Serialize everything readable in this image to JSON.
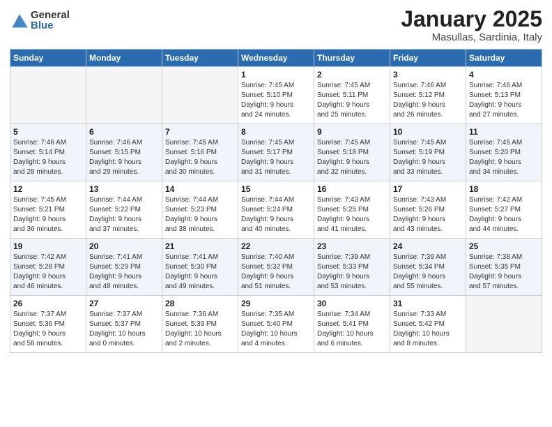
{
  "header": {
    "logo_general": "General",
    "logo_blue": "Blue",
    "month": "January 2025",
    "location": "Masullas, Sardinia, Italy"
  },
  "weekdays": [
    "Sunday",
    "Monday",
    "Tuesday",
    "Wednesday",
    "Thursday",
    "Friday",
    "Saturday"
  ],
  "weeks": [
    [
      {
        "day": "",
        "info": ""
      },
      {
        "day": "",
        "info": ""
      },
      {
        "day": "",
        "info": ""
      },
      {
        "day": "1",
        "info": "Sunrise: 7:45 AM\nSunset: 5:10 PM\nDaylight: 9 hours\nand 24 minutes."
      },
      {
        "day": "2",
        "info": "Sunrise: 7:45 AM\nSunset: 5:11 PM\nDaylight: 9 hours\nand 25 minutes."
      },
      {
        "day": "3",
        "info": "Sunrise: 7:46 AM\nSunset: 5:12 PM\nDaylight: 9 hours\nand 26 minutes."
      },
      {
        "day": "4",
        "info": "Sunrise: 7:46 AM\nSunset: 5:13 PM\nDaylight: 9 hours\nand 27 minutes."
      }
    ],
    [
      {
        "day": "5",
        "info": "Sunrise: 7:46 AM\nSunset: 5:14 PM\nDaylight: 9 hours\nand 28 minutes."
      },
      {
        "day": "6",
        "info": "Sunrise: 7:46 AM\nSunset: 5:15 PM\nDaylight: 9 hours\nand 29 minutes."
      },
      {
        "day": "7",
        "info": "Sunrise: 7:45 AM\nSunset: 5:16 PM\nDaylight: 9 hours\nand 30 minutes."
      },
      {
        "day": "8",
        "info": "Sunrise: 7:45 AM\nSunset: 5:17 PM\nDaylight: 9 hours\nand 31 minutes."
      },
      {
        "day": "9",
        "info": "Sunrise: 7:45 AM\nSunset: 5:18 PM\nDaylight: 9 hours\nand 32 minutes."
      },
      {
        "day": "10",
        "info": "Sunrise: 7:45 AM\nSunset: 5:19 PM\nDaylight: 9 hours\nand 33 minutes."
      },
      {
        "day": "11",
        "info": "Sunrise: 7:45 AM\nSunset: 5:20 PM\nDaylight: 9 hours\nand 34 minutes."
      }
    ],
    [
      {
        "day": "12",
        "info": "Sunrise: 7:45 AM\nSunset: 5:21 PM\nDaylight: 9 hours\nand 36 minutes."
      },
      {
        "day": "13",
        "info": "Sunrise: 7:44 AM\nSunset: 5:22 PM\nDaylight: 9 hours\nand 37 minutes."
      },
      {
        "day": "14",
        "info": "Sunrise: 7:44 AM\nSunset: 5:23 PM\nDaylight: 9 hours\nand 38 minutes."
      },
      {
        "day": "15",
        "info": "Sunrise: 7:44 AM\nSunset: 5:24 PM\nDaylight: 9 hours\nand 40 minutes."
      },
      {
        "day": "16",
        "info": "Sunrise: 7:43 AM\nSunset: 5:25 PM\nDaylight: 9 hours\nand 41 minutes."
      },
      {
        "day": "17",
        "info": "Sunrise: 7:43 AM\nSunset: 5:26 PM\nDaylight: 9 hours\nand 43 minutes."
      },
      {
        "day": "18",
        "info": "Sunrise: 7:42 AM\nSunset: 5:27 PM\nDaylight: 9 hours\nand 44 minutes."
      }
    ],
    [
      {
        "day": "19",
        "info": "Sunrise: 7:42 AM\nSunset: 5:28 PM\nDaylight: 9 hours\nand 46 minutes."
      },
      {
        "day": "20",
        "info": "Sunrise: 7:41 AM\nSunset: 5:29 PM\nDaylight: 9 hours\nand 48 minutes."
      },
      {
        "day": "21",
        "info": "Sunrise: 7:41 AM\nSunset: 5:30 PM\nDaylight: 9 hours\nand 49 minutes."
      },
      {
        "day": "22",
        "info": "Sunrise: 7:40 AM\nSunset: 5:32 PM\nDaylight: 9 hours\nand 51 minutes."
      },
      {
        "day": "23",
        "info": "Sunrise: 7:39 AM\nSunset: 5:33 PM\nDaylight: 9 hours\nand 53 minutes."
      },
      {
        "day": "24",
        "info": "Sunrise: 7:39 AM\nSunset: 5:34 PM\nDaylight: 9 hours\nand 55 minutes."
      },
      {
        "day": "25",
        "info": "Sunrise: 7:38 AM\nSunset: 5:35 PM\nDaylight: 9 hours\nand 57 minutes."
      }
    ],
    [
      {
        "day": "26",
        "info": "Sunrise: 7:37 AM\nSunset: 5:36 PM\nDaylight: 9 hours\nand 58 minutes."
      },
      {
        "day": "27",
        "info": "Sunrise: 7:37 AM\nSunset: 5:37 PM\nDaylight: 10 hours\nand 0 minutes."
      },
      {
        "day": "28",
        "info": "Sunrise: 7:36 AM\nSunset: 5:39 PM\nDaylight: 10 hours\nand 2 minutes."
      },
      {
        "day": "29",
        "info": "Sunrise: 7:35 AM\nSunset: 5:40 PM\nDaylight: 10 hours\nand 4 minutes."
      },
      {
        "day": "30",
        "info": "Sunrise: 7:34 AM\nSunset: 5:41 PM\nDaylight: 10 hours\nand 6 minutes."
      },
      {
        "day": "31",
        "info": "Sunrise: 7:33 AM\nSunset: 5:42 PM\nDaylight: 10 hours\nand 8 minutes."
      },
      {
        "day": "",
        "info": ""
      }
    ]
  ]
}
